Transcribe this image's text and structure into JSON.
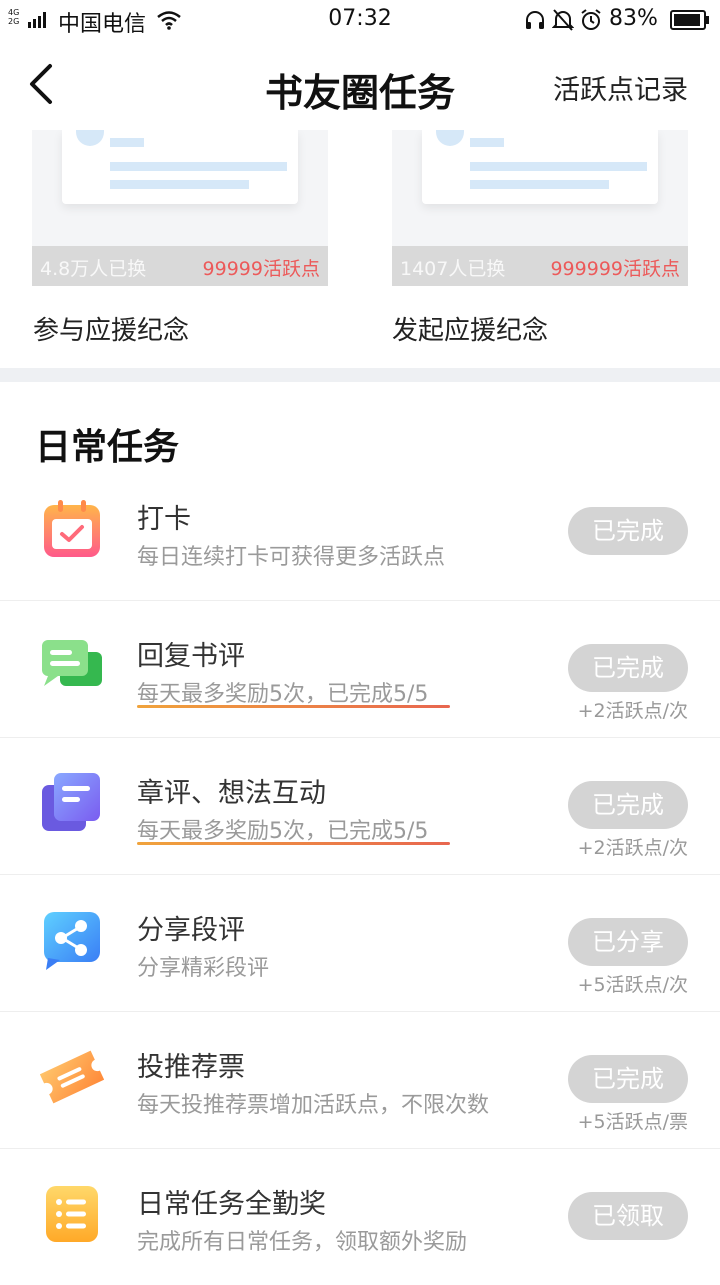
{
  "status_bar": {
    "network_label_top": "4G",
    "network_label_bottom": "2G",
    "carrier": "中国电信",
    "time": "07:32",
    "battery": "83%",
    "icons": [
      "signal-icon",
      "wifi-icon",
      "headset-icon",
      "mute-icon",
      "alarm-icon",
      "battery-icon"
    ]
  },
  "header": {
    "back_icon": "back-arrow-icon",
    "title": "书友圈任务",
    "record_link": "活跃点记录"
  },
  "rewards": [
    {
      "count": "4.8万人已换",
      "points": "99999活跃点",
      "label": "参与应援纪念"
    },
    {
      "count": "1407人已换",
      "points": "999999活跃点",
      "label": "发起应援纪念"
    }
  ],
  "daily": {
    "title": "日常任务",
    "tasks": [
      {
        "icon": "calendar-check-icon",
        "title": "打卡",
        "desc": "每日连续打卡可获得更多活跃点",
        "button": "已完成",
        "reward": ""
      },
      {
        "icon": "chat-bubbles-icon",
        "title": "回复书评",
        "desc": "每天最多奖励5次，已完成5/5",
        "button": "已完成",
        "reward": "+2活跃点/次"
      },
      {
        "icon": "notes-stack-icon",
        "title": "章评、想法互动",
        "desc": "每天最多奖励5次，已完成5/5",
        "button": "已完成",
        "reward": "+2活跃点/次"
      },
      {
        "icon": "share-icon",
        "title": "分享段评",
        "desc": "分享精彩段评",
        "button": "已分享",
        "reward": "+5活跃点/次"
      },
      {
        "icon": "ticket-icon",
        "title": "投推荐票",
        "desc": "每天投推荐票增加活跃点，不限次数",
        "button": "已完成",
        "reward": "+5活跃点/票"
      },
      {
        "icon": "list-icon",
        "title": "日常任务全勤奖",
        "desc": "完成所有日常任务，领取额外奖励",
        "button": "已领取",
        "reward": ""
      }
    ]
  },
  "colors": {
    "accent_red": "#ec5a5a",
    "button_disabled": "#d4d4d4",
    "underline_start": "#f0a33c",
    "underline_end": "#e8664f"
  }
}
